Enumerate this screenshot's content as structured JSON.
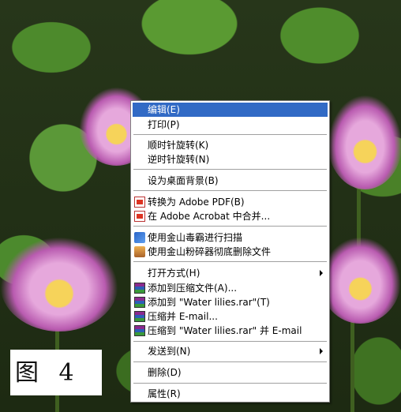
{
  "caption": {
    "text": "图 4"
  },
  "context_menu": {
    "items": [
      {
        "label": "编辑(E)",
        "highlighted": true,
        "icon": null,
        "submenu": false
      },
      {
        "label": "打印(P)",
        "icon": null,
        "submenu": false
      },
      {
        "label": "顺时针旋转(K)",
        "icon": null,
        "submenu": false
      },
      {
        "label": "逆时针旋转(N)",
        "icon": null,
        "submenu": false
      },
      {
        "label": "设为桌面背景(B)",
        "icon": null,
        "submenu": false
      },
      {
        "label": "转换为 Adobe PDF(B)",
        "icon": "pdf-icon",
        "submenu": false
      },
      {
        "label": "在 Adobe Acrobat 中合并...",
        "icon": "pdf-icon",
        "submenu": false
      },
      {
        "label": "使用金山毒霸进行扫描",
        "icon": "antivirus-scan-icon",
        "submenu": false
      },
      {
        "label": "使用金山粉碎器彻底删除文件",
        "icon": "shredder-icon",
        "submenu": false
      },
      {
        "label": "打开方式(H)",
        "icon": null,
        "submenu": true
      },
      {
        "label": "添加到压缩文件(A)...",
        "icon": "rar-icon",
        "submenu": false
      },
      {
        "label": "添加到 \"Water lilies.rar\"(T)",
        "icon": "rar-icon",
        "submenu": false
      },
      {
        "label": "压缩并 E-mail...",
        "icon": "rar-icon",
        "submenu": false
      },
      {
        "label": "压缩到 \"Water lilies.rar\" 并 E-mail",
        "icon": "rar-icon",
        "submenu": false
      },
      {
        "label": "发送到(N)",
        "icon": null,
        "submenu": true
      },
      {
        "label": "删除(D)",
        "icon": null,
        "submenu": false
      },
      {
        "label": "属性(R)",
        "icon": null,
        "submenu": false
      }
    ]
  },
  "colors": {
    "highlight": "#316ac5",
    "menu_bg": "#ffffff",
    "separator": "#a0a0a0"
  }
}
